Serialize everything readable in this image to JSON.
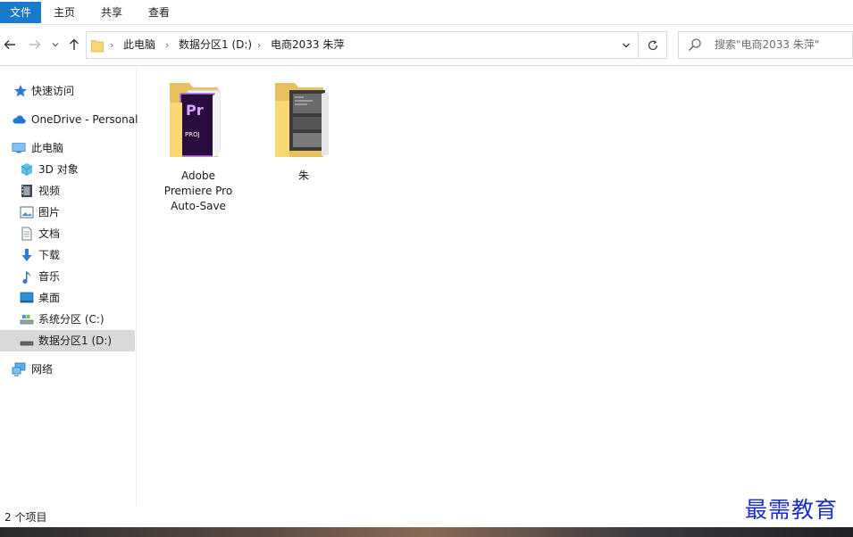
{
  "ribbon": {
    "tabs": [
      "文件",
      "主页",
      "共享",
      "查看"
    ]
  },
  "nav": {
    "back_icon": "arrow-left-icon",
    "forward_icon": "arrow-right-icon",
    "recent_icon": "chevron-down-icon",
    "up_icon": "arrow-up-icon",
    "breadcrumbs": [
      "此电脑",
      "数据分区1 (D:)",
      "电商2033 朱萍"
    ],
    "refresh_icon": "refresh-icon"
  },
  "search": {
    "placeholder": "搜索\"电商2033 朱萍\""
  },
  "sidebar": {
    "items": [
      {
        "label": "快速访问",
        "icon": "star-icon"
      },
      {
        "label": "OneDrive - Personal",
        "icon": "cloud-icon"
      },
      {
        "label": "此电脑",
        "icon": "computer-icon"
      },
      {
        "label": "3D 对象",
        "icon": "cube-icon"
      },
      {
        "label": "视频",
        "icon": "film-icon"
      },
      {
        "label": "图片",
        "icon": "picture-icon"
      },
      {
        "label": "文档",
        "icon": "document-icon"
      },
      {
        "label": "下载",
        "icon": "download-icon"
      },
      {
        "label": "音乐",
        "icon": "music-icon"
      },
      {
        "label": "桌面",
        "icon": "desktop-icon"
      },
      {
        "label": "系统分区 (C:)",
        "icon": "drive-icon"
      },
      {
        "label": "数据分区1 (D:)",
        "icon": "drive-icon"
      },
      {
        "label": "网络",
        "icon": "network-icon"
      }
    ],
    "selected_index": 11
  },
  "files": [
    {
      "name": "Adobe Premiere Pro Auto-Save",
      "icon": "premiere-folder-icon",
      "badge": "Pr",
      "sub_badge": "PROJ"
    },
    {
      "name": "朱",
      "icon": "folder-with-images-icon"
    }
  ],
  "status": {
    "count_text": "2 个项目"
  },
  "watermark": "最需教育",
  "colors": {
    "accent": "#1979ca",
    "selected": "#d9d9d9",
    "folder": "#f8d775",
    "premiere": "#2a0b3d",
    "watermark": "#1a2ec8"
  }
}
